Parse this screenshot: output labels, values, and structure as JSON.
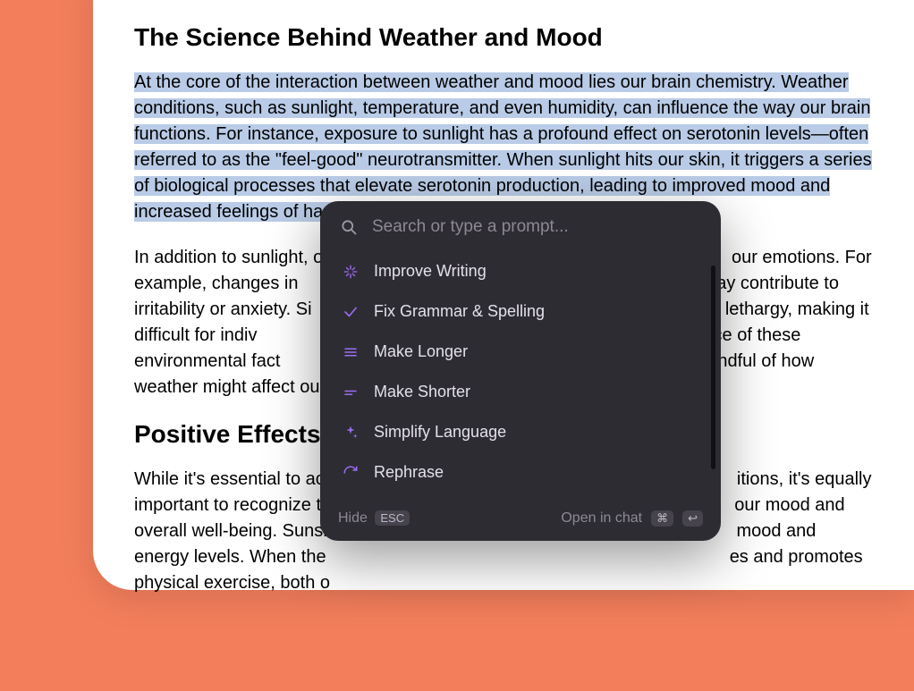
{
  "document": {
    "heading1": "The Science Behind Weather and Mood",
    "para1": "At the core of the interaction between weather and mood lies our brain chemistry. Weather conditions, such as sunlight, temperature, and even humidity, can influence the way our brain functions. For instance, exposure to sunlight has a profound effect on serotonin levels—often referred to as the \"feel-good\" neurotransmitter. When sunlight hits our skin, it triggers a series of biological processes that elevate serotonin production, leading to improved mood and increased feelings of happiness.",
    "para2a": "In addition to sunlight, ot",
    "para2b": "our emotions. For example, changes in",
    "para2c": "may contribute to irritability or anxiety. Si",
    "para2d": "f lethargy, making it difficult for indiv",
    "para2e": "influence of these environmental fact",
    "para2f": "g mindful of how weather might affect our",
    "heading2": "Positive Effects",
    "para3a": "While it's essential to ack",
    "para3b": "itions, it's equally important to recognize th",
    "para3c": "our mood and overall well-being. Sunsh",
    "para3d": "mood and energy levels. When the",
    "para3e": "es and promotes physical exercise, both o"
  },
  "popup": {
    "search_placeholder": "Search or type a prompt...",
    "items": [
      {
        "label": "Improve Writing"
      },
      {
        "label": "Fix Grammar & Spelling"
      },
      {
        "label": "Make Longer"
      },
      {
        "label": "Make Shorter"
      },
      {
        "label": "Simplify Language"
      },
      {
        "label": "Rephrase"
      }
    ],
    "footer_hide": "Hide",
    "footer_hide_key": "ESC",
    "footer_open": "Open in chat",
    "footer_open_key1": "⌘",
    "footer_open_key2": "↩"
  }
}
